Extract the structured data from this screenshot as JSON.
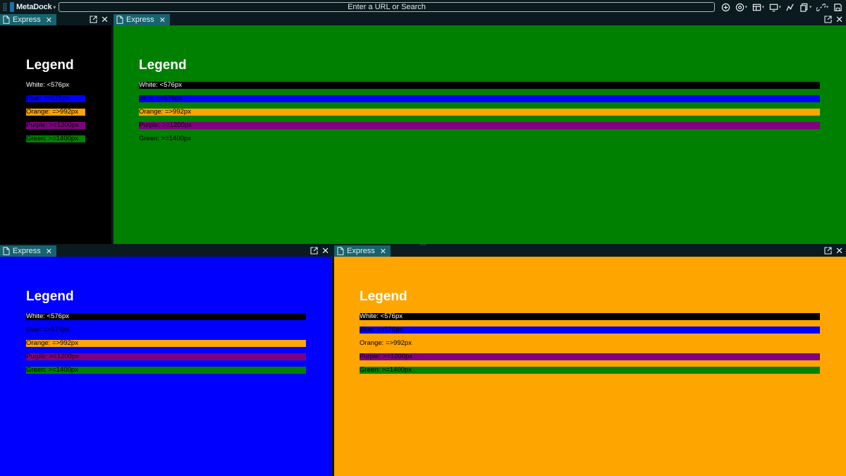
{
  "app": {
    "name": "MetaDock",
    "url_placeholder": "Enter a URL or Search"
  },
  "toolbar_icons": [
    "add-circle-icon",
    "at-sign-icon",
    "layout-icon",
    "monitor-icon",
    "graph-icon",
    "copy-icon",
    "link-icon",
    "save-icon"
  ],
  "panels": {
    "top_left": {
      "tab": "Express",
      "background": "#000000",
      "legend_title": "Legend",
      "rows": [
        "White: <576px",
        "Blue: =>576px",
        "Orange: =>992px",
        "Purple: >=1200px",
        "Green: >=1400px"
      ]
    },
    "top_right": {
      "tab": "Express",
      "background": "#008000",
      "legend_title": "Legend",
      "rows": [
        "White: <576px",
        "Blue: =>576px",
        "Orange: =>992px",
        "Purple: >=1200px",
        "Green: >=1400px"
      ]
    },
    "bottom_left": {
      "tab": "Express",
      "background": "#0000ff",
      "legend_title": "Legend",
      "rows": [
        "White: <576px",
        "Blue: =>576px",
        "Orange: =>992px",
        "Purple: >=1200px",
        "Green: >=1400px"
      ]
    },
    "bottom_right": {
      "tab": "Express",
      "background": "#ffa500",
      "legend_title": "Legend",
      "rows": [
        "White: <576px",
        "Blue: =>576px",
        "Orange: =>992px",
        "Purple: >=1200px",
        "Green: >=1400px"
      ]
    }
  },
  "colors": {
    "white_row": "#000000",
    "blue_row": "#0000ff",
    "orange_row": "#ffa500",
    "purple_row": "#800080",
    "green_row": "#008000",
    "tab_active": "#17636e",
    "chrome": "#0b1a1e"
  }
}
